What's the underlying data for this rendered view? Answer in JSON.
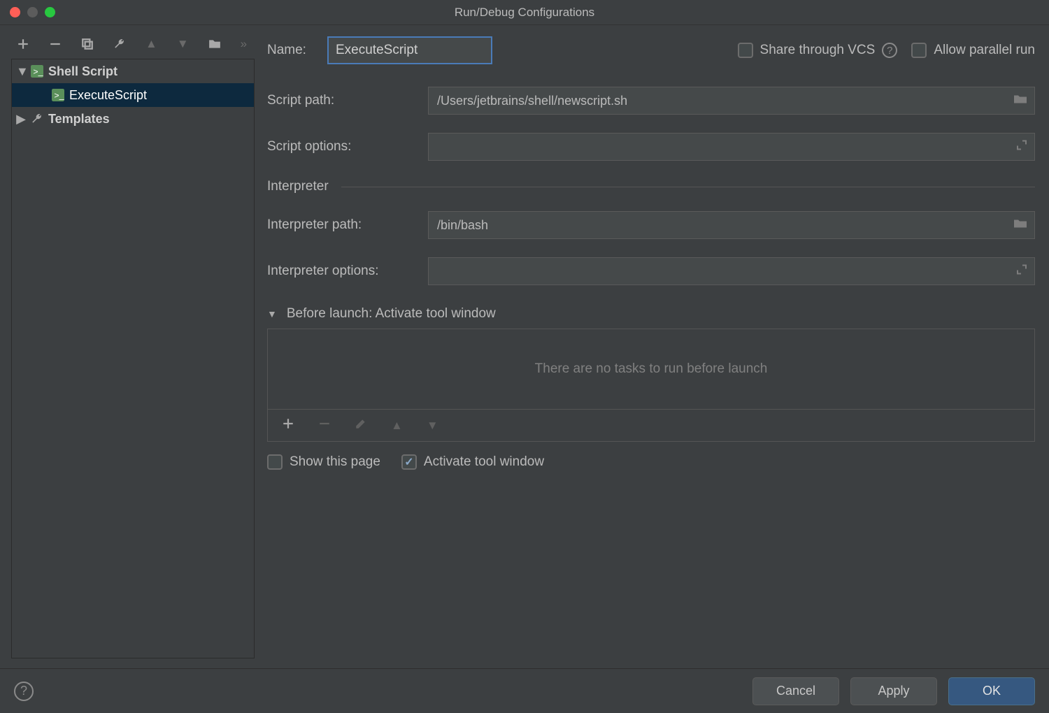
{
  "window": {
    "title": "Run/Debug Configurations"
  },
  "sidebar": {
    "items": [
      {
        "label": "Shell Script"
      },
      {
        "label": "ExecuteScript"
      },
      {
        "label": "Templates"
      }
    ]
  },
  "form": {
    "name_label": "Name:",
    "name_value": "ExecuteScript",
    "share_label": "Share through VCS",
    "allow_parallel_label": "Allow parallel run",
    "script_path_label": "Script path:",
    "script_path_value": "/Users/jetbrains/shell/newscript.sh",
    "script_options_label": "Script options:",
    "script_options_value": "",
    "interpreter_section": "Interpreter",
    "interpreter_path_label": "Interpreter path:",
    "interpreter_path_value": "/bin/bash",
    "interpreter_options_label": "Interpreter options:",
    "interpreter_options_value": ""
  },
  "before_launch": {
    "header": "Before launch: Activate tool window",
    "empty_text": "There are no tasks to run before launch",
    "show_this_page": "Show this page",
    "activate_tool_window": "Activate tool window"
  },
  "footer": {
    "cancel": "Cancel",
    "apply": "Apply",
    "ok": "OK"
  }
}
